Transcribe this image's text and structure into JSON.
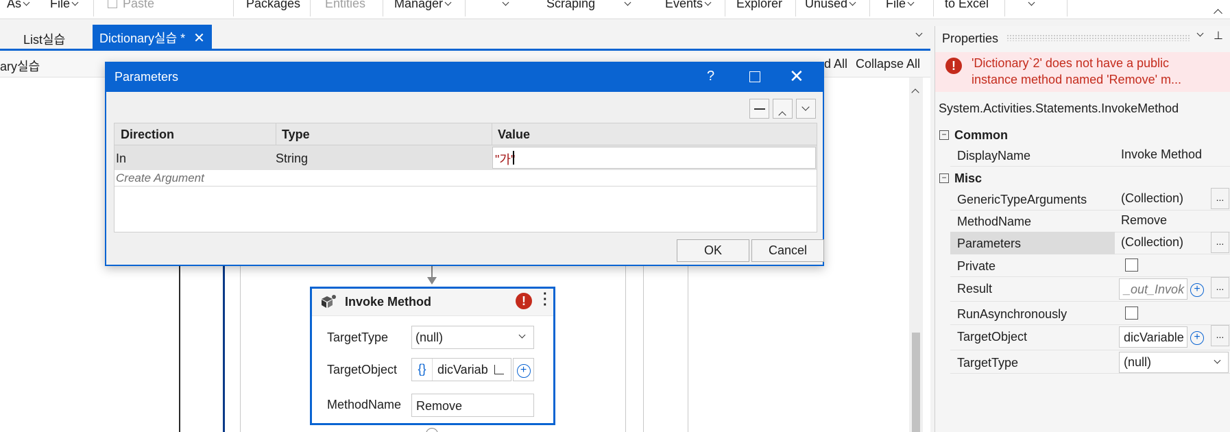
{
  "ribbon": {
    "items": [
      "As",
      "File",
      "Paste",
      "Packages",
      "Entities",
      "Manager",
      "Scraping",
      "Events",
      "Explorer",
      "Unused",
      "File",
      "to Excel"
    ]
  },
  "tabs": [
    {
      "label": "List실습"
    },
    {
      "label": "Dictionary실습 *"
    }
  ],
  "breadcrumb": {
    "text": "ary실습"
  },
  "designer": {
    "expand_all": "d All",
    "collapse_all": "Collapse All"
  },
  "dialog": {
    "title": "Parameters",
    "help": "?",
    "headers": [
      "Direction",
      "Type",
      "Value"
    ],
    "row": {
      "direction": "In",
      "type": "String",
      "value": "\"가\""
    },
    "create_argument": "Create Argument",
    "ok": "OK",
    "cancel": "Cancel"
  },
  "invoke": {
    "title": "Invoke Method",
    "target_type_label": "TargetType",
    "target_type_value": "(null)",
    "target_object_label": "TargetObject",
    "target_object_value": "dicVariab",
    "braces": "{}",
    "method_name_label": "MethodName",
    "method_name_value": "Remove"
  },
  "properties": {
    "title": "Properties",
    "error_line1": "'Dictionary`2' does not have a public",
    "error_line2": "instance method named 'Remove' m...",
    "type_name": "System.Activities.Statements.InvokeMethod",
    "sections": {
      "common": "Common",
      "misc": "Misc"
    },
    "rows": {
      "display_name": {
        "name": "DisplayName",
        "value": "Invoke Method"
      },
      "generic_type_arguments": {
        "name": "GenericTypeArguments",
        "value": "(Collection)"
      },
      "method_name": {
        "name": "MethodName",
        "value": "Remove"
      },
      "parameters": {
        "name": "Parameters",
        "value": "(Collection)"
      },
      "private": {
        "name": "Private"
      },
      "result": {
        "name": "Result",
        "value": "_out_Invok"
      },
      "run_async": {
        "name": "RunAsynchronously"
      },
      "target_object": {
        "name": "TargetObject",
        "value": "dicVariable"
      },
      "target_type": {
        "name": "TargetType",
        "value": "(null)"
      }
    },
    "ellipsis": "..."
  },
  "colors": {
    "accent": "#0a64d2",
    "error": "#c42b1c",
    "error_bg": "#fde7e9"
  }
}
